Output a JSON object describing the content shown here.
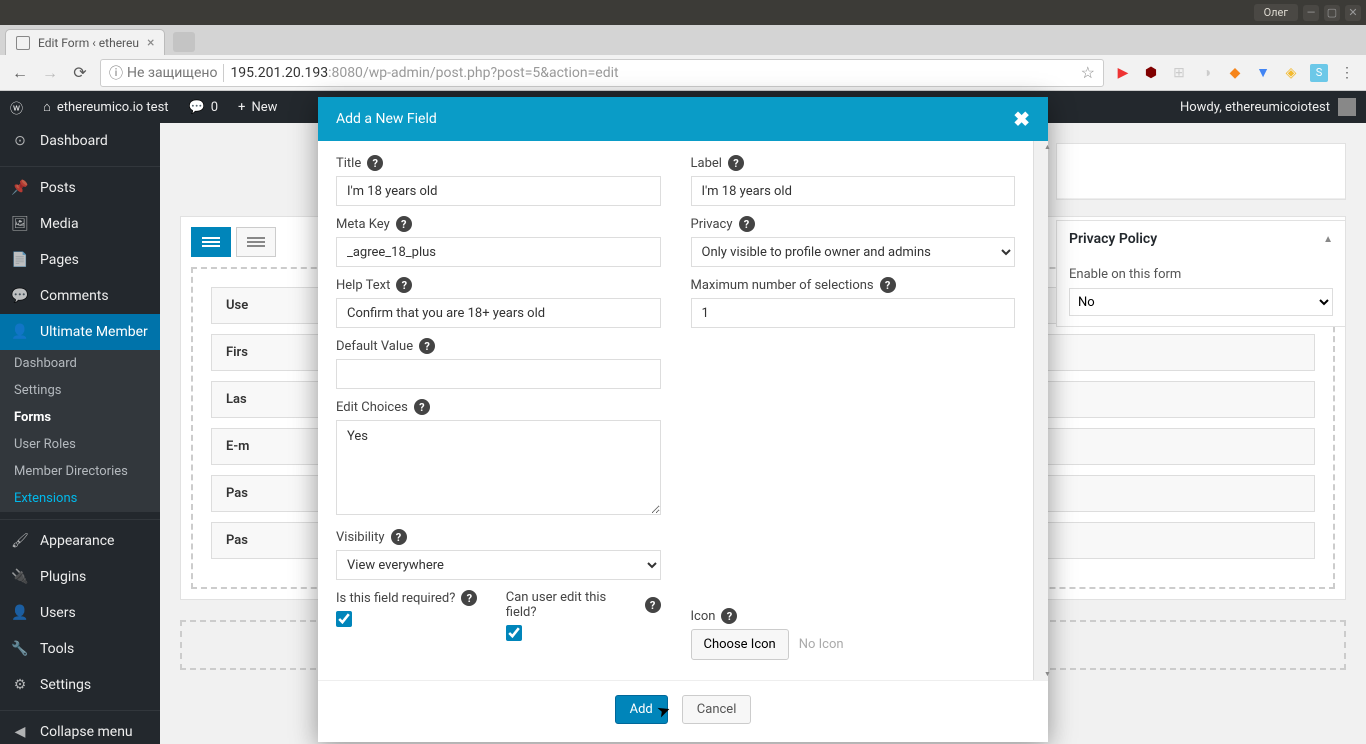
{
  "titlebar": {
    "user": "Олег"
  },
  "browser": {
    "tab_title": "Edit Form ‹ ethereu",
    "insecure_label": "Не защищено",
    "url_host": "195.201.20.193",
    "url_port": ":8080",
    "url_path": "/wp-admin/post.php?post=5&action=edit"
  },
  "wpbar": {
    "site": "ethereumico.io test",
    "comments": "0",
    "new": "New",
    "howdy": "Howdy, ethereumicoiotest"
  },
  "sidebar": {
    "dashboard": "Dashboard",
    "posts": "Posts",
    "media": "Media",
    "pages": "Pages",
    "comments": "Comments",
    "um": "Ultimate Member",
    "sub_dashboard": "Dashboard",
    "sub_settings": "Settings",
    "sub_forms": "Forms",
    "sub_roles": "User Roles",
    "sub_dirs": "Member Directories",
    "sub_ext": "Extensions",
    "appearance": "Appearance",
    "plugins": "Plugins",
    "users": "Users",
    "tools": "Tools",
    "settings": "Settings",
    "collapse": "Collapse menu"
  },
  "builder": {
    "fields": [
      "Use",
      "Firs",
      "Las",
      "E-m",
      "Pas",
      "Pas"
    ]
  },
  "meta": {
    "privacy_title": "Privacy Policy",
    "enable_label": "Enable on this form",
    "enable_value": "No"
  },
  "modal": {
    "title": "Add a New Field",
    "labels": {
      "title": "Title",
      "label": "Label",
      "metakey": "Meta Key",
      "privacy": "Privacy",
      "help": "Help Text",
      "maxsel": "Maximum number of selections",
      "default": "Default Value",
      "choices": "Edit Choices",
      "visibility": "Visibility",
      "required": "Is this field required?",
      "editable": "Can user edit this field?",
      "icon": "Icon"
    },
    "values": {
      "title": "I'm 18 years old",
      "label": "I'm 18 years old",
      "metakey": "_agree_18_plus",
      "privacy": "Only visible to profile owner and admins",
      "help": "Confirm that you are 18+ years old",
      "maxsel": "1",
      "default": "",
      "choices": "Yes",
      "visibility": "View everywhere",
      "choose_icon": "Choose Icon",
      "no_icon": "No Icon"
    },
    "buttons": {
      "add": "Add",
      "cancel": "Cancel"
    }
  }
}
